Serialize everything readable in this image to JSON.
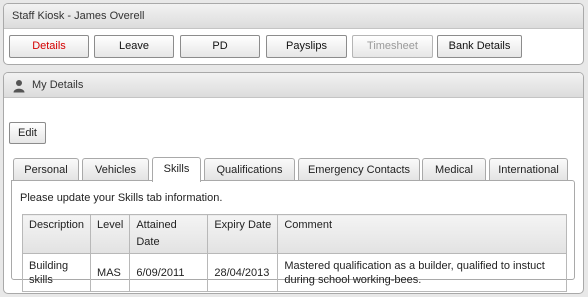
{
  "kiosk": {
    "title": "Staff Kiosk - James Overell",
    "buttons": [
      {
        "label": "Details"
      },
      {
        "label": "Leave"
      },
      {
        "label": "PD"
      },
      {
        "label": "Payslips"
      },
      {
        "label": "Timesheet"
      },
      {
        "label": "Bank Details"
      }
    ],
    "active_color": "#d40000"
  },
  "details": {
    "title": "My Details",
    "edit_label": "Edit",
    "tabs": [
      {
        "label": "Personal"
      },
      {
        "label": "Vehicles"
      },
      {
        "label": "Skills"
      },
      {
        "label": "Qualifications"
      },
      {
        "label": "Emergency Contacts"
      },
      {
        "label": "Medical"
      },
      {
        "label": "International"
      }
    ],
    "selected_tab": "Skills",
    "message": "Please update your Skills tab information.",
    "table": {
      "columns": [
        "Description",
        "Level",
        "Attained Date",
        "Expiry Date",
        "Comment"
      ],
      "rows": [
        [
          "Building skills",
          "MAS",
          "6/09/2011",
          "28/04/2013",
          "Mastered qualification as a builder, qualified to instuct during school working-bees."
        ]
      ]
    }
  }
}
